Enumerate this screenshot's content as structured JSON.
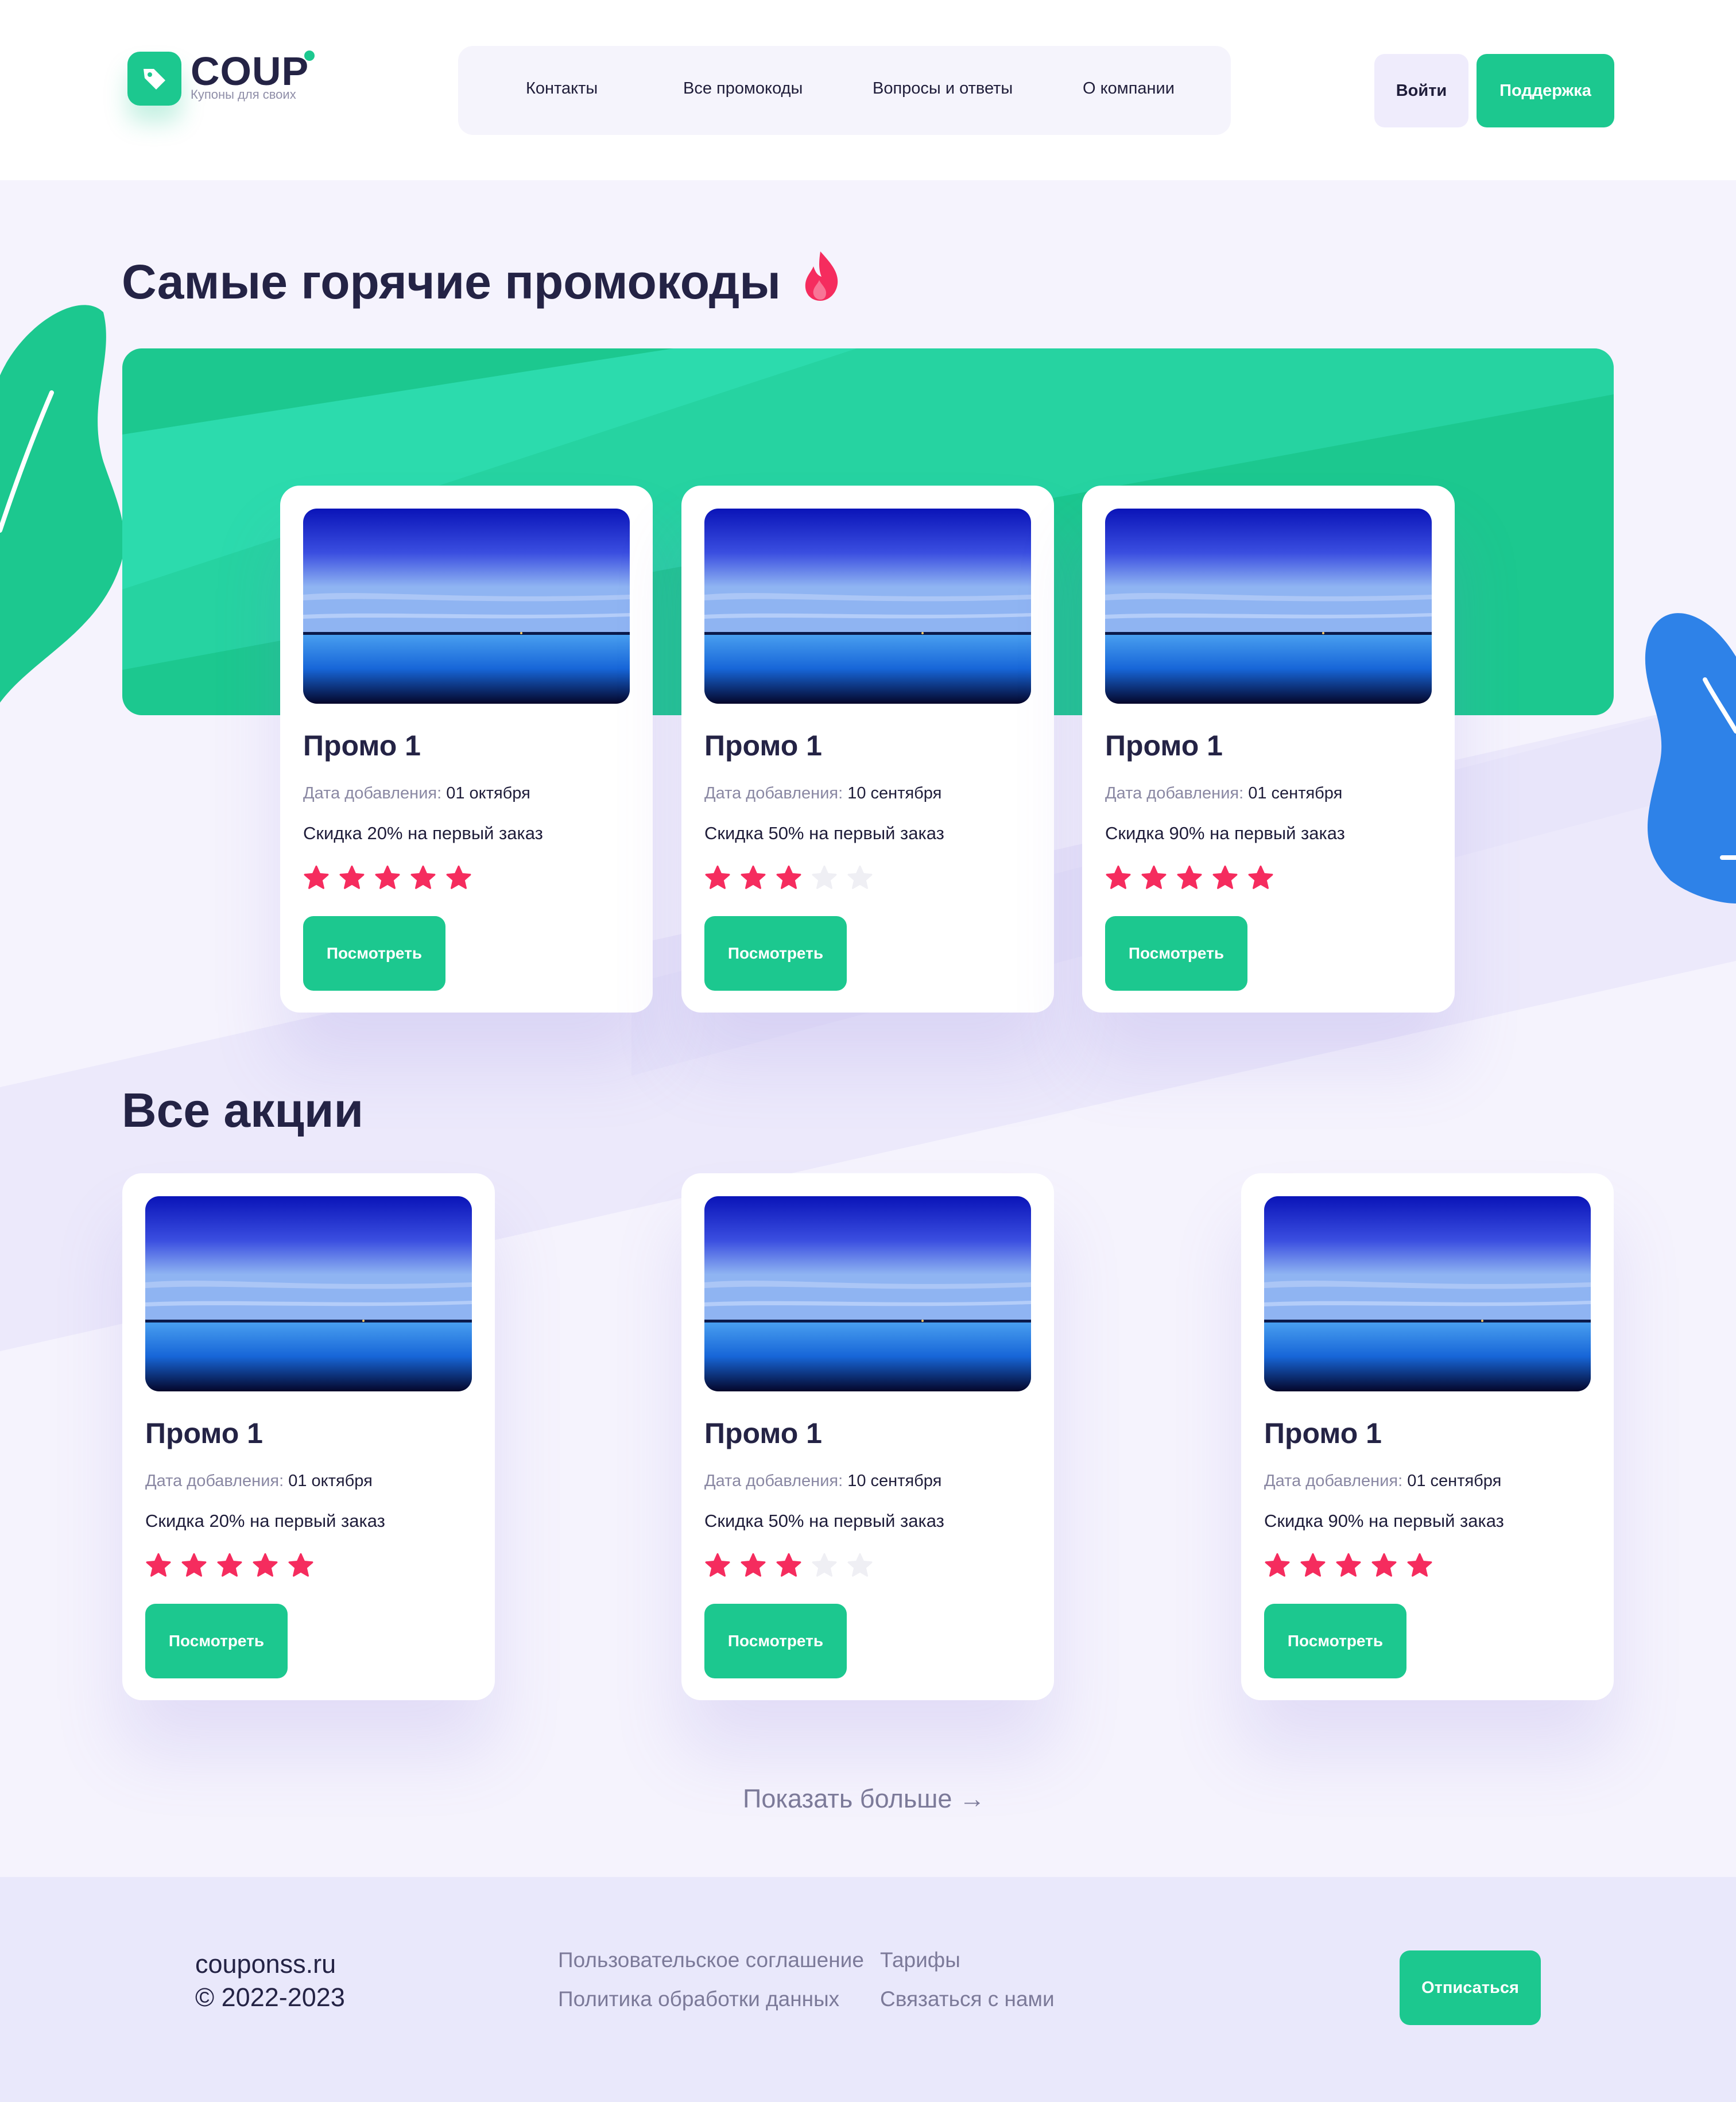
{
  "colors": {
    "accent_green": "#1cc88f",
    "accent_green_light": "#2fddb0",
    "star_active": "#f52c5e",
    "star_inactive": "#efeff4",
    "leaf_blue": "#2e82e8",
    "text_dark": "#242345",
    "text_muted": "#8a88a3"
  },
  "header": {
    "logo": {
      "name": "COUP",
      "tagline": "Купоны для своих"
    },
    "nav": [
      {
        "label": "Контакты"
      },
      {
        "label": "Все промокоды"
      },
      {
        "label": "Вопросы и ответы"
      },
      {
        "label": "О компании"
      }
    ],
    "login_label": "Войти",
    "support_label": "Поддержка"
  },
  "hot_section": {
    "title": "Самые горячие промокоды",
    "title_icon": "fire-icon",
    "cards": [
      {
        "title": "Промо 1",
        "date_label": "Дата добавления:",
        "date": "01 октября",
        "description": "Скидка 20% на первый заказ",
        "rating": 5,
        "rating_max": 5,
        "button_label": "Посмотреть"
      },
      {
        "title": "Промо 1",
        "date_label": "Дата добавления:",
        "date": "10 сентября",
        "description": "Скидка 50% на первый заказ",
        "rating": 3,
        "rating_max": 5,
        "button_label": "Посмотреть"
      },
      {
        "title": "Промо 1",
        "date_label": "Дата добавления:",
        "date": "01 сентября",
        "description": "Скидка 90% на первый заказ",
        "rating": 5,
        "rating_max": 5,
        "button_label": "Посмотреть"
      }
    ]
  },
  "all_section": {
    "title": "Все акции",
    "cards": [
      {
        "title": "Промо 1",
        "date_label": "Дата добавления:",
        "date": "01 октября",
        "description": "Скидка 20% на первый заказ",
        "rating": 5,
        "rating_max": 5,
        "button_label": "Посмотреть"
      },
      {
        "title": "Промо 1",
        "date_label": "Дата добавления:",
        "date": "10 сентября",
        "description": "Скидка 50% на первый заказ",
        "rating": 3,
        "rating_max": 5,
        "button_label": "Посмотреть"
      },
      {
        "title": "Промо 1",
        "date_label": "Дата добавления:",
        "date": "01 сентября",
        "description": "Скидка 90% на первый заказ",
        "rating": 5,
        "rating_max": 5,
        "button_label": "Посмотреть"
      }
    ],
    "show_more_label": "Показать больше →"
  },
  "footer": {
    "site": "couponss.ru",
    "copyright": "© 2022-2023",
    "links": [
      {
        "label": "Пользовательское соглашение"
      },
      {
        "label": "Тарифы"
      },
      {
        "label": "Политика обработки данных"
      },
      {
        "label": "Связаться с нами"
      }
    ],
    "unsubscribe_label": "Отписаться"
  }
}
